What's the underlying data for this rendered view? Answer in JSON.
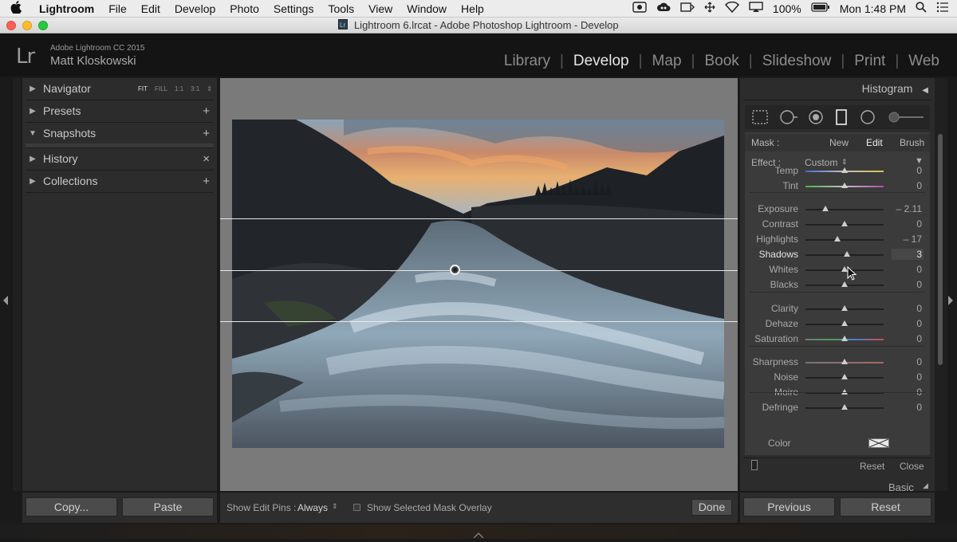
{
  "menubar": {
    "apple": "",
    "app": "Lightroom",
    "items": [
      "File",
      "Edit",
      "Develop",
      "Photo",
      "Settings",
      "Tools",
      "View",
      "Window",
      "Help"
    ],
    "battery": "100%",
    "clock": "Mon 1:48 PM"
  },
  "window": {
    "title": "Lightroom 6.lrcat - Adobe Photoshop Lightroom - Develop"
  },
  "identity": {
    "logo": "Lr",
    "product": "Adobe Lightroom CC 2015",
    "user": "Matt Kloskowski"
  },
  "modules": [
    "Library",
    "Develop",
    "Map",
    "Book",
    "Slideshow",
    "Print",
    "Web"
  ],
  "active_module": "Develop",
  "left_panel": {
    "navigator": {
      "label": "Navigator",
      "zoom": [
        "FIT",
        "FILL",
        "1:1",
        "3:1"
      ]
    },
    "presets": {
      "label": "Presets"
    },
    "snapshots": {
      "label": "Snapshots"
    },
    "history": {
      "label": "History"
    },
    "collections": {
      "label": "Collections"
    },
    "copy": "Copy...",
    "paste": "Paste"
  },
  "toolbar": {
    "edit_pins_label": "Show Edit Pins :",
    "edit_pins_value": "Always",
    "overlay_label": "Show Selected Mask Overlay",
    "done": "Done"
  },
  "right_panel": {
    "histogram": "Histogram",
    "mask": {
      "label": "Mask :",
      "new": "New",
      "edit": "Edit",
      "brush": "Brush"
    },
    "effect": {
      "label": "Effect :",
      "value": "Custom"
    },
    "sliders": {
      "temp": {
        "label": "Temp",
        "value": "0"
      },
      "tint": {
        "label": "Tint",
        "value": "0"
      },
      "exposure": {
        "label": "Exposure",
        "value": "– 2.11"
      },
      "contrast": {
        "label": "Contrast",
        "value": "0"
      },
      "highlights": {
        "label": "Highlights",
        "value": "– 17"
      },
      "shadows": {
        "label": "Shadows",
        "value": "3"
      },
      "whites": {
        "label": "Whites",
        "value": "0"
      },
      "blacks": {
        "label": "Blacks",
        "value": "0"
      },
      "clarity": {
        "label": "Clarity",
        "value": "0"
      },
      "dehaze": {
        "label": "Dehaze",
        "value": "0"
      },
      "saturation": {
        "label": "Saturation",
        "value": "0"
      },
      "sharpness": {
        "label": "Sharpness",
        "value": "0"
      },
      "noise": {
        "label": "Noise",
        "value": "0"
      },
      "moire": {
        "label": "Moire",
        "value": "0"
      },
      "defringe": {
        "label": "Defringe",
        "value": "0"
      }
    },
    "color": "Color",
    "reset": "Reset",
    "close": "Close",
    "basic": "Basic",
    "previous_btn": "Previous",
    "reset_btn": "Reset"
  }
}
